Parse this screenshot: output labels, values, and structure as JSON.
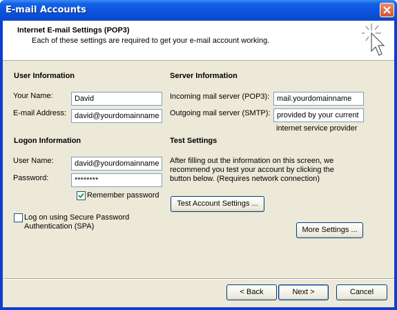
{
  "window": {
    "title": "E-mail Accounts"
  },
  "header": {
    "title": "Internet E-mail Settings (POP3)",
    "subtitle": "Each of these settings are required to get your e-mail account working."
  },
  "user_info": {
    "heading": "User Information",
    "name_label": "Your Name:",
    "name_value": "David",
    "email_label": "E-mail Address:",
    "email_value": "david@yourdomainname"
  },
  "server_info": {
    "heading": "Server Information",
    "incoming_label": "Incoming mail server (POP3):",
    "incoming_value": "mail.yourdomainname",
    "outgoing_label": "Outgoing mail server (SMTP):",
    "outgoing_value": "provided by your current",
    "outgoing_note": "internet service provider"
  },
  "logon_info": {
    "heading": "Logon Information",
    "user_label": "User Name:",
    "user_value": "david@yourdomainname",
    "password_label": "Password:",
    "password_value": "********",
    "remember_label": "Remember password",
    "remember_checked": true,
    "spa_label_line1": "Log on using Secure Password",
    "spa_label_line2": "Authentication (SPA)",
    "spa_checked": false
  },
  "test_settings": {
    "heading": "Test Settings",
    "line1": "After filling out the information on this screen, we",
    "line2": "recommend you test your account by clicking the",
    "line3": "button below. (Requires network connection)",
    "test_button": "Test Account Settings ...",
    "more_button": "More Settings ..."
  },
  "footer": {
    "back": "< Back",
    "next": "Next >",
    "cancel": "Cancel"
  }
}
